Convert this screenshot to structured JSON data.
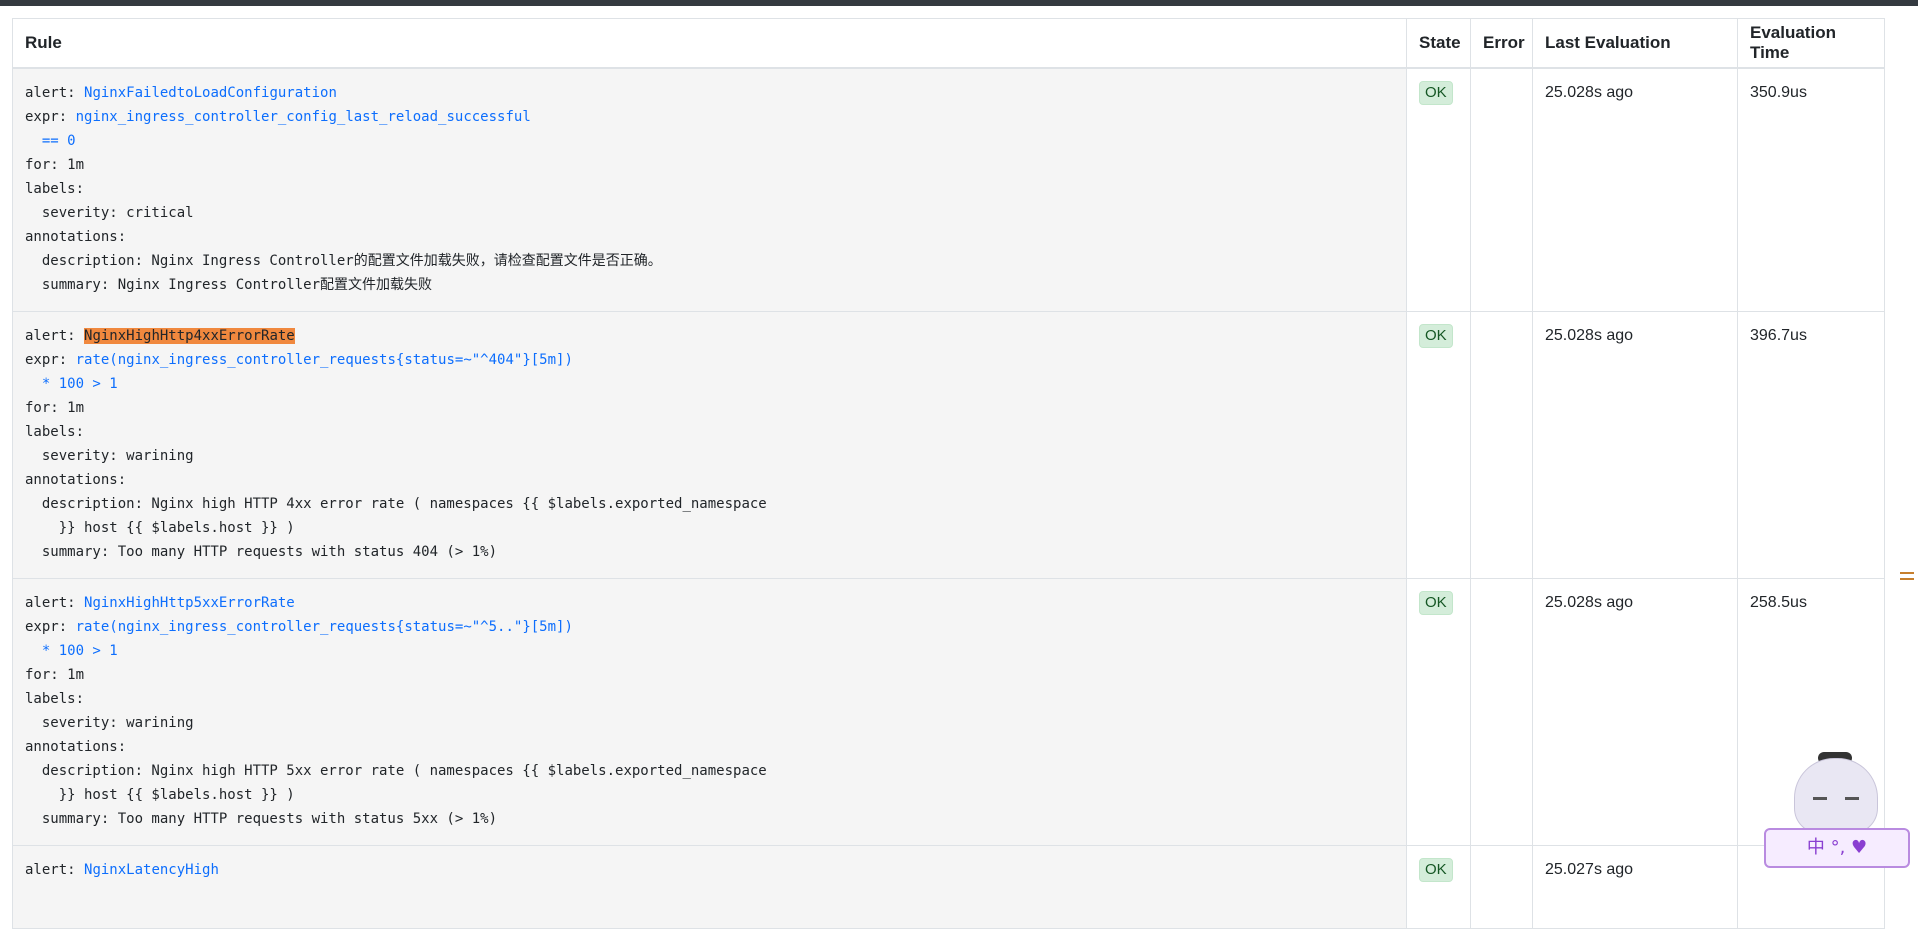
{
  "table": {
    "headers": {
      "rule": "Rule",
      "state": "State",
      "error": "Error",
      "last_evaluation": "Last Evaluation",
      "evaluation_time": "Evaluation Time"
    },
    "rows": [
      {
        "alert_key": "alert:",
        "alert_name": "NginxFailedtoLoadConfiguration",
        "expr_key": "expr:",
        "expr_line1": "nginx_ingress_controller_config_last_reload_successful",
        "expr_line2": "  == 0",
        "for_line": "for: 1m",
        "labels_line": "labels:",
        "severity_line": "  severity: critical",
        "annotations_line": "annotations:",
        "description_line1": "  description: Nginx Ingress Controller的配置文件加载失败，请检查配置文件是否正确。",
        "description_line2": "",
        "summary_line": "  summary: Nginx Ingress Controller配置文件加载失败",
        "state": "OK",
        "error": "",
        "last_evaluation": "25.028s ago",
        "evaluation_time": "350.9us"
      },
      {
        "alert_key": "alert:",
        "alert_name": "NginxHighHttp4xxErrorRate",
        "expr_key": "expr:",
        "expr_line1": "rate(nginx_ingress_controller_requests{status=~\"^404\"}[5m])",
        "expr_line2": "  * 100 > 1",
        "for_line": "for: 1m",
        "labels_line": "labels:",
        "severity_line": "  severity: warining",
        "annotations_line": "annotations:",
        "description_line1": "  description: Nginx high HTTP 4xx error rate ( namespaces {{ $labels.exported_namespace",
        "description_line2": "    }} host {{ $labels.host }} )",
        "summary_line": "  summary: Too many HTTP requests with status 404 (> 1%)",
        "state": "OK",
        "error": "",
        "last_evaluation": "25.028s ago",
        "evaluation_time": "396.7us"
      },
      {
        "alert_key": "alert:",
        "alert_name": "NginxHighHttp5xxErrorRate",
        "expr_key": "expr:",
        "expr_line1": "rate(nginx_ingress_controller_requests{status=~\"^5..\"}[5m])",
        "expr_line2": "  * 100 > 1",
        "for_line": "for: 1m",
        "labels_line": "labels:",
        "severity_line": "  severity: warining",
        "annotations_line": "annotations:",
        "description_line1": "  description: Nginx high HTTP 5xx error rate ( namespaces {{ $labels.exported_namespace",
        "description_line2": "    }} host {{ $labels.host }} )",
        "summary_line": "  summary: Too many HTTP requests with status 5xx (> 1%)",
        "state": "OK",
        "error": "",
        "last_evaluation": "25.028s ago",
        "evaluation_time": "258.5us"
      },
      {
        "alert_key": "alert:",
        "alert_name": "NginxLatencyHigh",
        "state": "OK",
        "last_evaluation": "25.027s ago"
      }
    ]
  },
  "ime_widget": {
    "label": "中 °, ♥"
  },
  "colors": {
    "highlight": "#f0883e",
    "link": "#0d6efd",
    "ok_badge_bg": "#d4edda"
  }
}
